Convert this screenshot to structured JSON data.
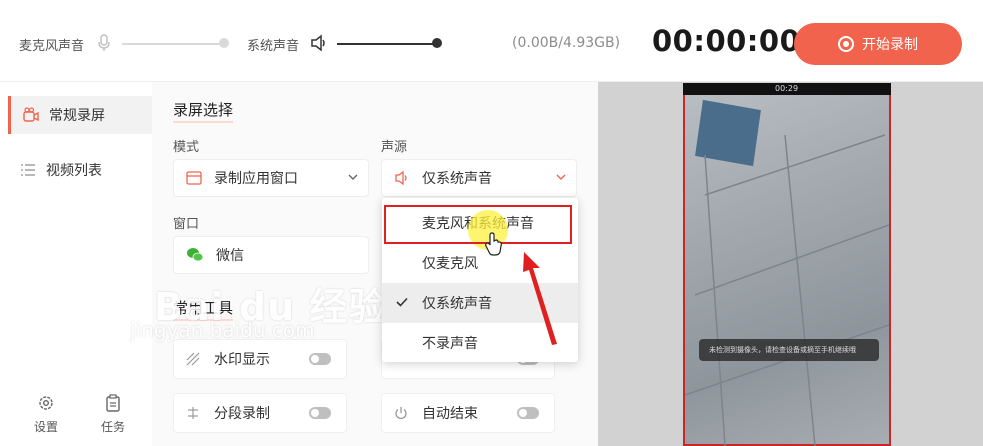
{
  "topbar": {
    "mic_label": "麦克风声音",
    "system_label": "系统声音",
    "storage": "(0.00B/4.93GB)",
    "timer": "00:00:00",
    "record_button": "开始录制",
    "mic_volume": 1.0,
    "system_volume": 1.0
  },
  "sidebar": {
    "items": [
      {
        "label": "常规录屏",
        "active": true
      },
      {
        "label": "视频列表",
        "active": false
      }
    ],
    "bottom": [
      {
        "label": "设置",
        "icon": "gear-icon"
      },
      {
        "label": "任务",
        "icon": "clipboard-icon"
      }
    ]
  },
  "main": {
    "section_record": "录屏选择",
    "mode_label": "模式",
    "mode_value": "录制应用窗口",
    "audio_label": "声源",
    "audio_value": "仅系统声音",
    "window_label": "窗口",
    "window_value": "微信",
    "section_tools": "常用工具",
    "tools": [
      {
        "label": "水印显示",
        "enabled": false
      },
      {
        "label": "分段录制",
        "enabled": false
      },
      {
        "label": "自动结束",
        "enabled": false
      }
    ]
  },
  "dropdown": {
    "options": [
      "麦克风和系统声音",
      "仅麦克风",
      "仅系统声音",
      "不录声音"
    ],
    "selected_index": 2,
    "highlighted_index": 0
  },
  "preview": {
    "phone_time": "00:29",
    "toast": "未检测到摄像头，请检查设备或摘至手机继续哦"
  },
  "watermark": {
    "brand": "Bai du 经验",
    "url": "jingyan.baidu.com"
  },
  "colors": {
    "accent": "#f2634d",
    "highlight_box": "#e02020"
  }
}
